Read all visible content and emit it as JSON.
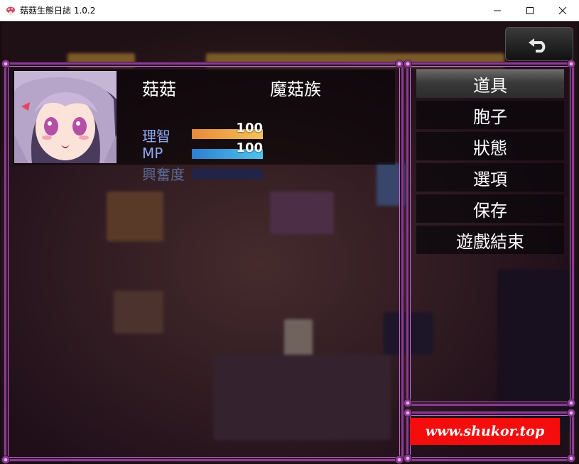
{
  "window": {
    "title": "菇菇生態日誌 1.0.2",
    "app_icon": "mushroom-icon",
    "controls": {
      "minimize": "—",
      "maximize": "☐",
      "close": "✕"
    }
  },
  "back_button": {
    "icon": "return-arrow-icon"
  },
  "status": {
    "name": "菇菇",
    "class": "魔菇族",
    "stats": [
      {
        "label": "理智",
        "value": "100",
        "fill": 1.0,
        "color_start": "#e8893a",
        "color_end": "#f4c25a"
      },
      {
        "label": "MP",
        "value": "100",
        "fill": 1.0,
        "color_start": "#2c7fd0",
        "color_end": "#4fc3ef"
      },
      {
        "label": "興奮度",
        "value": "",
        "fill": 0.0,
        "color_start": "#c0307a",
        "color_end": "#f06aa8"
      }
    ]
  },
  "menu": {
    "items": [
      {
        "label": "道具",
        "selected": true
      },
      {
        "label": "胞子",
        "selected": false
      },
      {
        "label": "狀態",
        "selected": false
      },
      {
        "label": "選項",
        "selected": false
      },
      {
        "label": "保存",
        "selected": false
      },
      {
        "label": "遊戲結束",
        "selected": false
      }
    ]
  },
  "watermark": {
    "text": "www.shukor.top",
    "color": "#f50d0d"
  }
}
